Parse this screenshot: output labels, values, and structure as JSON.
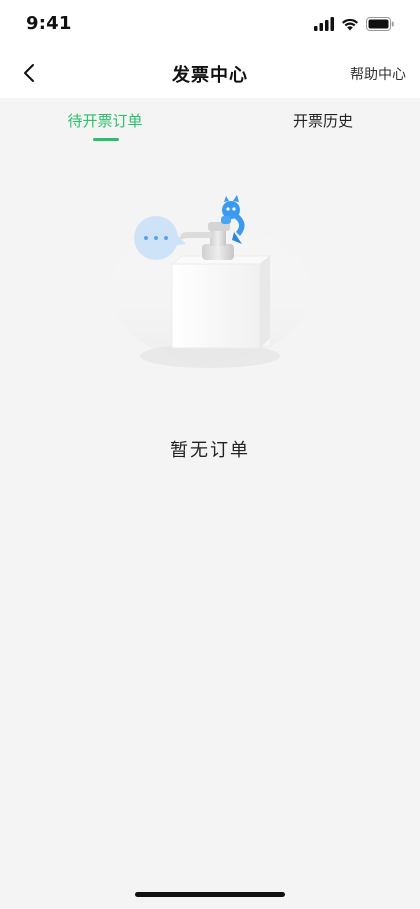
{
  "status_bar": {
    "time": "9:41"
  },
  "nav": {
    "title": "发票中心",
    "help_label": "帮助中心"
  },
  "tabs": [
    {
      "label": "待开票订单",
      "active": true
    },
    {
      "label": "开票历史",
      "active": false
    }
  ],
  "empty_state": {
    "message": "暂无订单"
  },
  "colors": {
    "accent": "#2cbf6e",
    "background": "#f4f4f4",
    "bubble": "#cfe3f8",
    "mascot": "#3a9af0"
  }
}
